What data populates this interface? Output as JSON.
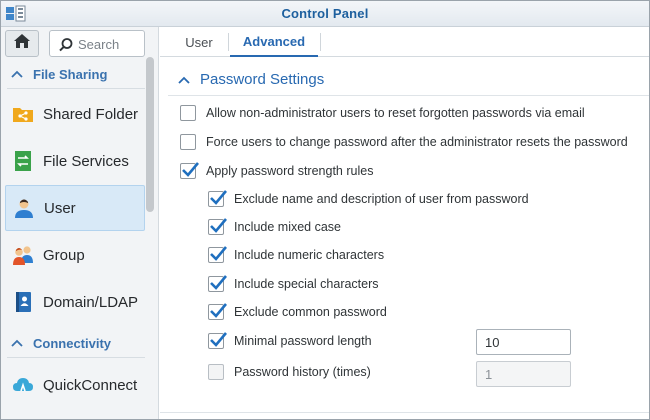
{
  "window": {
    "title": "Control Panel",
    "app_icon": "control-panel-icon"
  },
  "sidebar": {
    "home_icon": "home-icon",
    "search": {
      "placeholder": "Search",
      "value": ""
    },
    "sections": [
      {
        "label": "File Sharing"
      },
      {
        "label": "Connectivity"
      }
    ],
    "items": [
      {
        "label": "Shared Folder",
        "icon": "shared-folder-icon"
      },
      {
        "label": "File Services",
        "icon": "file-services-icon"
      },
      {
        "label": "User",
        "icon": "user-icon",
        "active": true
      },
      {
        "label": "Group",
        "icon": "group-icon"
      },
      {
        "label": "Domain/LDAP",
        "icon": "domain-ldap-icon"
      },
      {
        "label": "QuickConnect",
        "icon": "quickconnect-icon"
      }
    ]
  },
  "main": {
    "tabs": [
      {
        "label": "User",
        "active": false
      },
      {
        "label": "Advanced",
        "active": true
      }
    ],
    "section_title": "Password Settings",
    "options": [
      {
        "label": "Allow non-administrator users to reset forgotten passwords via email",
        "checked": false
      },
      {
        "label": "Force users to change password after the administrator resets the password",
        "checked": false
      },
      {
        "label": "Apply password strength rules",
        "checked": true
      }
    ],
    "strength_rules": [
      {
        "label": "Exclude name and description of user from password",
        "checked": true
      },
      {
        "label": "Include mixed case",
        "checked": true
      },
      {
        "label": "Include numeric characters",
        "checked": true
      },
      {
        "label": "Include special characters",
        "checked": true
      },
      {
        "label": "Exclude common password",
        "checked": true
      },
      {
        "label": "Minimal password length",
        "checked": true,
        "value": "10"
      },
      {
        "label": "Password history (times)",
        "checked": false,
        "value": "1",
        "disabled": true
      }
    ]
  },
  "colors": {
    "accent": "#2869b1",
    "active_bg": "#d8e9f7",
    "check": "#1f6fbf"
  }
}
